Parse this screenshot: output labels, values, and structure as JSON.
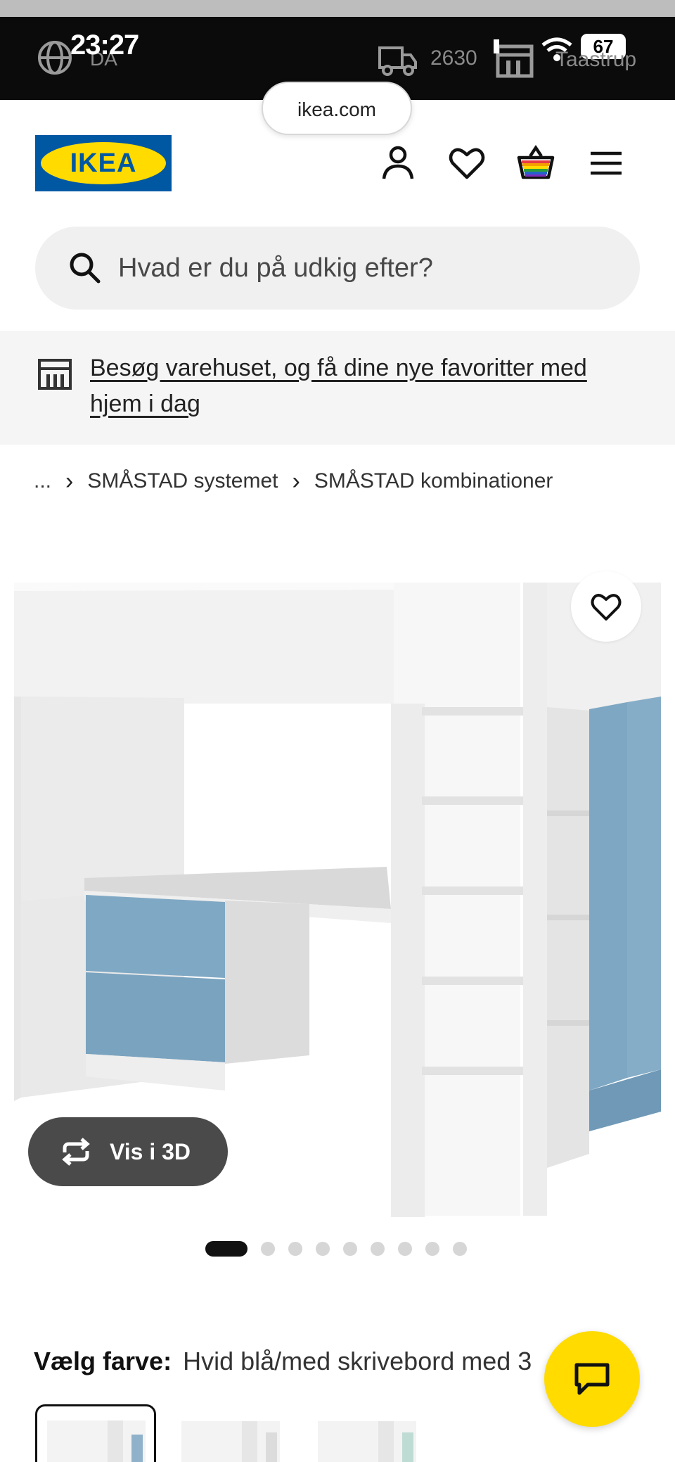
{
  "status_bar": {
    "time": "23:27",
    "language": "DA",
    "zip": "2630",
    "store": "Taastrup",
    "battery": "67"
  },
  "browser": {
    "url": "ikea.com"
  },
  "header": {
    "logo_text": "IKEA",
    "icons": [
      "user-icon",
      "heart-icon",
      "cart-icon",
      "menu-icon"
    ],
    "brand_colors": {
      "blue": "#0058a3",
      "yellow": "#ffdb00"
    }
  },
  "search": {
    "placeholder": "Hvad er du på udkig efter?"
  },
  "banner": {
    "text": "Besøg varehuset, og få dine nye favoritter med hjem i dag"
  },
  "breadcrumb": {
    "ellipsis": "...",
    "items": [
      "SMÅSTAD systemet",
      "SMÅSTAD kombinationer"
    ]
  },
  "product": {
    "view_3d_label": "Vis i 3D",
    "image_count": 9,
    "active_image": 1,
    "color_label": "Vælg farve:",
    "color_value": "Hvid blå/med skrivebord med 3"
  }
}
